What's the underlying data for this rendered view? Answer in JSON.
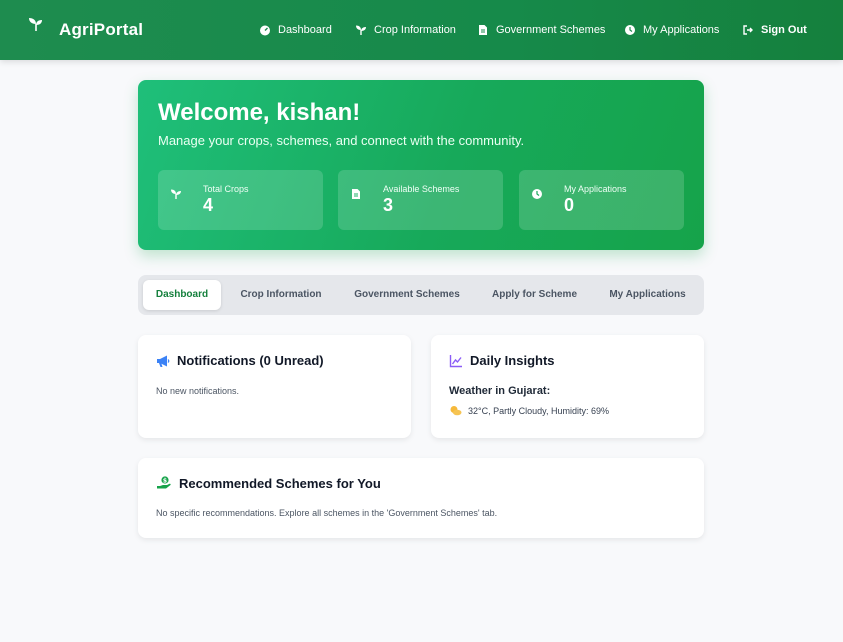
{
  "app": {
    "name": "AgriPortal"
  },
  "nav": {
    "dashboard": "Dashboard",
    "crop_info": "Crop Information",
    "schemes": "Government Schemes",
    "applications": "My Applications",
    "sign_out": "Sign Out"
  },
  "welcome": {
    "title": "Welcome, kishan!",
    "subtitle": "Manage your crops, schemes, and connect with the community.",
    "stats": [
      {
        "label": "Total Crops",
        "value": "4",
        "icon": "sprout-icon"
      },
      {
        "label": "Available Schemes",
        "value": "3",
        "icon": "document-icon"
      },
      {
        "label": "My Applications",
        "value": "0",
        "icon": "clock-icon"
      }
    ]
  },
  "tabs": [
    {
      "label": "Dashboard",
      "active": true
    },
    {
      "label": "Crop Information"
    },
    {
      "label": "Government Schemes"
    },
    {
      "label": "Apply for Scheme"
    },
    {
      "label": "My Applications"
    }
  ],
  "notifications": {
    "title": "Notifications (0 Unread)",
    "empty_text": "No new notifications."
  },
  "insights": {
    "title": "Daily Insights",
    "weather_heading": "Weather in Gujarat:",
    "weather_text": "32°C, Partly Cloudy, Humidity: 69%"
  },
  "recommended": {
    "title": "Recommended Schemes for You",
    "text": "No specific recommendations. Explore all schemes in the 'Government Schemes' tab."
  },
  "colors": {
    "brand_green": "#16a34a",
    "nav_green": "#1e8c4f",
    "active_tab": "#15803d",
    "notification_blue": "#3b82f6",
    "insights_purple": "#8b5cf6"
  }
}
